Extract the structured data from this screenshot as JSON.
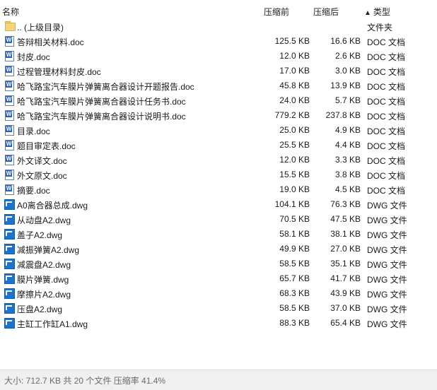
{
  "header": {
    "col_name": "名称",
    "col_before": "压缩前",
    "col_after": "压缩后",
    "col_type": "类型",
    "sort_arrow": "▲"
  },
  "rows": [
    {
      "name": ".. (上级目录)",
      "before": "",
      "after": "",
      "type": "文件夹",
      "icon": "folder-icon"
    },
    {
      "name": "答辩相关材料.doc",
      "before": "125.5 KB",
      "after": "16.6 KB",
      "type": "DOC 文档",
      "icon": "doc-icon"
    },
    {
      "name": "封皮.doc",
      "before": "12.0 KB",
      "after": "2.6 KB",
      "type": "DOC 文档",
      "icon": "doc-icon"
    },
    {
      "name": "过程管理材料封皮.doc",
      "before": "17.0 KB",
      "after": "3.0 KB",
      "type": "DOC 文档",
      "icon": "doc-icon"
    },
    {
      "name": "哈飞路宝汽车膜片弹簧离合器设计开题报告.doc",
      "before": "45.8 KB",
      "after": "13.9 KB",
      "type": "DOC 文档",
      "icon": "doc-icon"
    },
    {
      "name": "哈飞路宝汽车膜片弹簧离合器设计任务书.doc",
      "before": "24.0 KB",
      "after": "5.7 KB",
      "type": "DOC 文档",
      "icon": "doc-icon"
    },
    {
      "name": "哈飞路宝汽车膜片弹簧离合器设计说明书.doc",
      "before": "779.2 KB",
      "after": "237.8 KB",
      "type": "DOC 文档",
      "icon": "doc-icon"
    },
    {
      "name": "目录.doc",
      "before": "25.0 KB",
      "after": "4.9 KB",
      "type": "DOC 文档",
      "icon": "doc-icon"
    },
    {
      "name": "题目审定表.doc",
      "before": "25.5 KB",
      "after": "4.4 KB",
      "type": "DOC 文档",
      "icon": "doc-icon"
    },
    {
      "name": "外文译文.doc",
      "before": "12.0 KB",
      "after": "3.3 KB",
      "type": "DOC 文档",
      "icon": "doc-icon"
    },
    {
      "name": "外文原文.doc",
      "before": "15.5 KB",
      "after": "3.8 KB",
      "type": "DOC 文档",
      "icon": "doc-icon"
    },
    {
      "name": "摘要.doc",
      "before": "19.0 KB",
      "after": "4.5 KB",
      "type": "DOC 文档",
      "icon": "doc-icon"
    },
    {
      "name": "A0离合器总成.dwg",
      "before": "104.1 KB",
      "after": "76.3 KB",
      "type": "DWG 文件",
      "icon": "dwg-icon"
    },
    {
      "name": "从动盘A2.dwg",
      "before": "70.5 KB",
      "after": "47.5 KB",
      "type": "DWG 文件",
      "icon": "dwg-icon"
    },
    {
      "name": "盖子A2.dwg",
      "before": "58.1 KB",
      "after": "38.1 KB",
      "type": "DWG 文件",
      "icon": "dwg-icon"
    },
    {
      "name": "减振弹簧A2.dwg",
      "before": "49.9 KB",
      "after": "27.0 KB",
      "type": "DWG 文件",
      "icon": "dwg-icon"
    },
    {
      "name": "减震盘A2.dwg",
      "before": "58.5 KB",
      "after": "35.1 KB",
      "type": "DWG 文件",
      "icon": "dwg-icon"
    },
    {
      "name": "膜片弹簧.dwg",
      "before": "65.7 KB",
      "after": "41.7 KB",
      "type": "DWG 文件",
      "icon": "dwg-icon"
    },
    {
      "name": "摩擦片A2.dwg",
      "before": "68.3 KB",
      "after": "43.9 KB",
      "type": "DWG 文件",
      "icon": "dwg-icon"
    },
    {
      "name": "压盘A2.dwg",
      "before": "58.5 KB",
      "after": "37.0 KB",
      "type": "DWG 文件",
      "icon": "dwg-icon"
    },
    {
      "name": "主缸工作缸A1.dwg",
      "before": "88.3 KB",
      "after": "65.4 KB",
      "type": "DWG 文件",
      "icon": "dwg-icon"
    }
  ],
  "status": {
    "text": "大小: 712.7 KB 共 20 个文件 压缩率 41.4%"
  }
}
